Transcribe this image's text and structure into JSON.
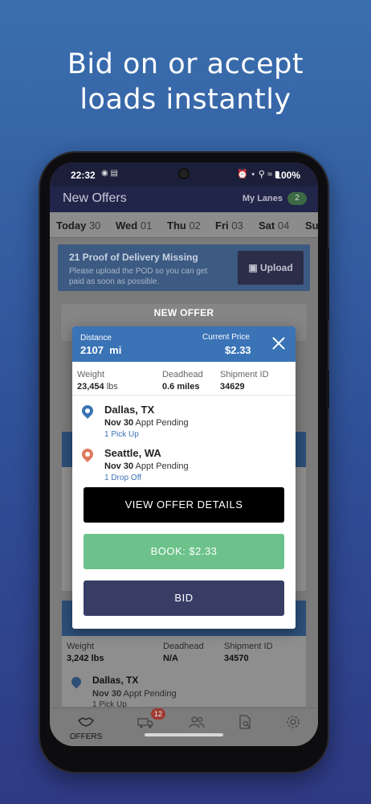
{
  "headline": {
    "line1": "Bid on or accept",
    "line2": "loads instantly"
  },
  "status_bar": {
    "time": "22:32",
    "battery": "100%"
  },
  "app_header": {
    "title": "New Offers",
    "my_lanes_label": "My Lanes",
    "my_lanes_count": "2"
  },
  "days": [
    {
      "day": "Today",
      "num": "30"
    },
    {
      "day": "Wed",
      "num": "01"
    },
    {
      "day": "Thu",
      "num": "02"
    },
    {
      "day": "Fri",
      "num": "03"
    },
    {
      "day": "Sat",
      "num": "04"
    },
    {
      "day": "Su",
      "num": ""
    }
  ],
  "pod_card": {
    "title": "21 Proof of Delivery Missing",
    "text": "Please upload the POD so you can get paid as soon as possible.",
    "upload_label": "Upload"
  },
  "background": {
    "offer2": {
      "weight_label": "Weight",
      "weight_value": "3,242",
      "weight_unit": "lbs",
      "deadhead_label": "Deadhead",
      "deadhead_value": "N/A",
      "shipment_label": "Shipment ID",
      "shipment_value": "34570",
      "city": "Dallas, TX",
      "date": "Nov 30",
      "status": "Appt Pending",
      "sub": "1 Pick Up"
    }
  },
  "modal": {
    "overlay_title": "NEW OFFER",
    "distance_label": "Distance",
    "distance_value": "2107  mi",
    "price_label": "Current Price",
    "price_value": "$2.33",
    "weight_label": "Weight",
    "weight_value": "23,454",
    "weight_unit": "lbs",
    "deadhead_label": "Deadhead",
    "deadhead_value": "0.6 miles",
    "shipment_label": "Shipment ID",
    "shipment_value": "34629",
    "pickup": {
      "city": "Dallas, TX",
      "date": "Nov 30",
      "status": "Appt Pending",
      "sub": "1 Pick Up",
      "pin_color": "#3a73b6"
    },
    "dropoff": {
      "city": "Seattle, WA",
      "date": "Nov 30",
      "status": "Appt Pending",
      "sub": "1 Drop Off",
      "pin_color": "#e07a5f"
    },
    "view_details_label": "VIEW OFFER DETAILS",
    "book_label": "BOOK: $2.33",
    "bid_label": "BID"
  },
  "bottom_nav": {
    "offers_label": "OFFERS",
    "loads_badge": "12"
  }
}
